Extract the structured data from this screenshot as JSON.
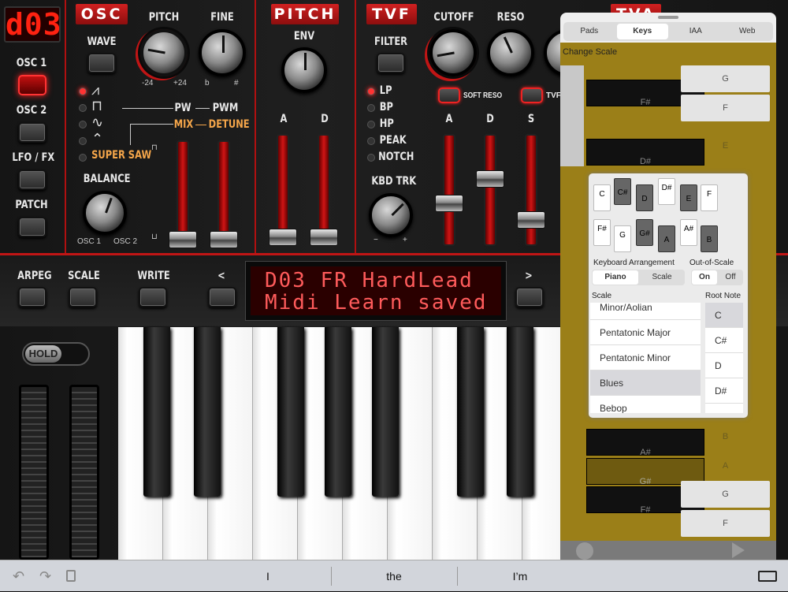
{
  "patch_display": "d03",
  "left_buttons": [
    {
      "label": "OSC 1",
      "active": true
    },
    {
      "label": "OSC 2",
      "active": false
    },
    {
      "label": "LFO / FX",
      "active": false
    },
    {
      "label": "PATCH",
      "active": false
    }
  ],
  "osc": {
    "title": "OSC",
    "wave_label": "WAVE",
    "pitch_label": "PITCH",
    "pitch_min": "-24",
    "pitch_max": "+24",
    "fine_label": "FINE",
    "fine_min": "b",
    "fine_max": "#",
    "pw_label": "PW",
    "pwm_label": "PWM",
    "mix_label": "MIX",
    "detune_label": "DETUNE",
    "supersaw_label": "SUPER SAW",
    "balance_label": "BALANCE",
    "balance_min": "OSC 1",
    "balance_max": "OSC 2"
  },
  "pitch": {
    "title": "PITCH",
    "env_label": "ENV",
    "a_label": "A",
    "d_label": "D"
  },
  "tvf": {
    "title": "TVF",
    "filter_label": "FILTER",
    "filter_types": [
      {
        "label": "LP",
        "on": true
      },
      {
        "label": "BP",
        "on": false
      },
      {
        "label": "HP",
        "on": false
      },
      {
        "label": "PEAK",
        "on": false
      },
      {
        "label": "NOTCH",
        "on": false
      }
    ],
    "cutoff_label": "CUTOFF",
    "reso_label": "RESO",
    "soft_reso_label": "SOFT RESO",
    "tvf_toggle_label": "TVF",
    "kbd_trk_label": "KBD TRK",
    "kbd_min": "−",
    "kbd_max": "+",
    "a_label": "A",
    "d_label": "D",
    "s_label": "S"
  },
  "tva_title": "TVA",
  "bar_buttons": {
    "arpeg": "ARPEG",
    "scale": "SCALE",
    "write": "WRITE",
    "prev": "<",
    "next": ">"
  },
  "lcd": {
    "line1": "D03 FR HardLead",
    "line2": "Midi Learn saved"
  },
  "hold_label": "HOLD",
  "popover": {
    "tabs": [
      {
        "label": "Pads",
        "selected": false
      },
      {
        "label": "Keys",
        "selected": true
      },
      {
        "label": "IAA",
        "selected": false
      },
      {
        "label": "Web",
        "selected": false
      }
    ],
    "change_scale": "Change Scale",
    "left_keys": [
      "F#",
      "D#",
      "A#",
      "G#",
      "F#"
    ],
    "right_keys": [
      "G",
      "F",
      "E",
      "B",
      "A",
      "G",
      "F"
    ],
    "mini_keys": {
      "row1_white": [
        "C",
        "D",
        "E",
        "F"
      ],
      "row1_black": [
        "C#",
        "D#"
      ],
      "row2_white": [
        "F#",
        "G",
        "A",
        "B"
      ],
      "row2_black": [
        "G#",
        "A#"
      ]
    },
    "keyboard_arrangement_label": "Keyboard Arrangement",
    "arrangement_options": [
      "Piano",
      "Scale"
    ],
    "arrangement_selected": "Piano",
    "out_of_scale_label": "Out-of-Scale",
    "out_of_scale_options": [
      "On",
      "Off"
    ],
    "out_of_scale_selected": "On",
    "scale_label": "Scale",
    "root_note_label": "Root Note",
    "scales": [
      "Minor/Aolian",
      "Pentatonic Major",
      "Pentatonic Minor",
      "Blues",
      "Bebop"
    ],
    "scale_selected": "Blues",
    "root_notes": [
      "C",
      "C#",
      "D",
      "D#"
    ],
    "root_selected": "C"
  },
  "keyboard_bar": {
    "suggestions": [
      "I",
      "the",
      "I’m"
    ]
  }
}
